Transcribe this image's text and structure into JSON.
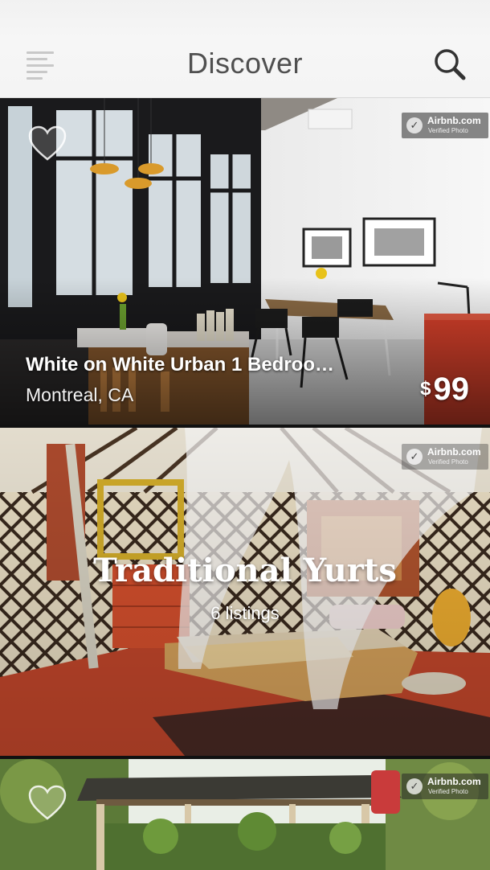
{
  "header": {
    "title": "Discover"
  },
  "listings": [
    {
      "title": "White on White Urban 1 Bedroo…",
      "location": "Montreal, CA",
      "currency": "$",
      "price": "99",
      "badge_name": "Airbnb.com",
      "badge_sub": "Verified Photo"
    },
    {
      "badge_name": "Airbnb.com",
      "badge_sub": "Verified Photo"
    }
  ],
  "collection": {
    "title": "Traditional Yurts",
    "count_label": "6 listings",
    "badge_name": "Airbnb.com",
    "badge_sub": "Verified Photo"
  },
  "icons": {
    "menu": "menu-icon",
    "search": "search-icon",
    "favorite": "heart-icon",
    "verified": "check-icon"
  },
  "colors": {
    "header_bg": "#f4f4f4",
    "title_text": "#505050",
    "accent_red": "#d9412b"
  }
}
